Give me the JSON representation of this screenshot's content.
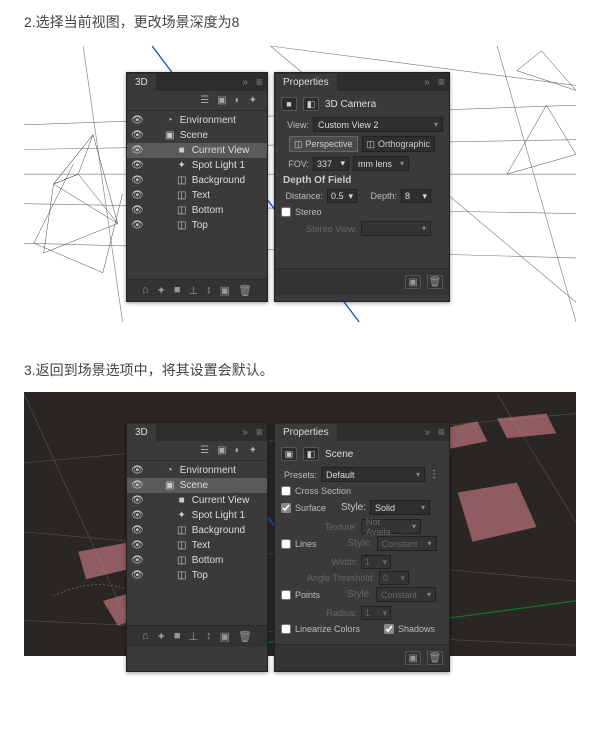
{
  "steps": {
    "step2": "2.选择当前视图，更改场景深度为8",
    "step3": "3.返回到场景选项中，将其设置会默认。"
  },
  "shot1": {
    "panel3d": {
      "title": "3D",
      "layers": [
        {
          "name": "Environment",
          "icon": "◔",
          "indent": 0,
          "selected": false
        },
        {
          "name": "Scene",
          "icon": "▣",
          "indent": 0,
          "selected": false
        },
        {
          "name": "Current View",
          "icon": "■",
          "indent": 1,
          "selected": true
        },
        {
          "name": "Spot Light 1",
          "icon": "✦",
          "indent": 1,
          "selected": false
        },
        {
          "name": "Background",
          "icon": "◫",
          "indent": 1,
          "selected": false
        },
        {
          "name": "Text",
          "icon": "◫",
          "indent": 1,
          "selected": false
        },
        {
          "name": "Bottom",
          "icon": "◫",
          "indent": 1,
          "selected": false
        },
        {
          "name": "Top",
          "icon": "◫",
          "indent": 1,
          "selected": false
        }
      ]
    },
    "props": {
      "title": "Properties",
      "type_label": "3D Camera",
      "view_label": "View:",
      "view_value": "Custom View 2",
      "btn_perspective": "Perspective",
      "btn_orthographic": "Orthographic",
      "fov_label": "FOV:",
      "fov_value": "337",
      "fov_unit": "mm lens",
      "dof_label": "Depth Of Field",
      "distance_label": "Distance:",
      "distance_value": "0.5",
      "depth_label": "Depth:",
      "depth_value": "8",
      "stereo_label": "Stereo",
      "stereo_view_label": "Stereo View:"
    }
  },
  "shot2": {
    "panel3d": {
      "title": "3D",
      "layers": [
        {
          "name": "Environment",
          "icon": "◔",
          "indent": 0,
          "selected": false
        },
        {
          "name": "Scene",
          "icon": "▣",
          "indent": 0,
          "selected": true
        },
        {
          "name": "Current View",
          "icon": "■",
          "indent": 1,
          "selected": false
        },
        {
          "name": "Spot Light 1",
          "icon": "✦",
          "indent": 1,
          "selected": false
        },
        {
          "name": "Background",
          "icon": "◫",
          "indent": 1,
          "selected": false
        },
        {
          "name": "Text",
          "icon": "◫",
          "indent": 1,
          "selected": false
        },
        {
          "name": "Bottom",
          "icon": "◫",
          "indent": 1,
          "selected": false
        },
        {
          "name": "Top",
          "icon": "◫",
          "indent": 1,
          "selected": false
        }
      ]
    },
    "props": {
      "title": "Properties",
      "type_label": "Scene",
      "presets_label": "Presets:",
      "presets_value": "Default",
      "cross_section_label": "Cross Section",
      "surface_label": "Surface",
      "surface_style_label": "Style:",
      "surface_style_value": "Solid",
      "surface_texture_label": "Texture:",
      "surface_texture_value": "Not Availa…",
      "lines_label": "Lines",
      "lines_style_label": "Style:",
      "lines_style_value": "Constant",
      "lines_width_label": "Width:",
      "lines_width_value": "1",
      "lines_angle_label": "Angle Threshold:",
      "lines_angle_value": "0",
      "points_label": "Points",
      "points_style_label": "Style:",
      "points_style_value": "Constant",
      "points_radius_label": "Radius:",
      "points_radius_value": "1",
      "linearize_label": "Linearize Colors",
      "shadows_label": "Shadows"
    }
  }
}
